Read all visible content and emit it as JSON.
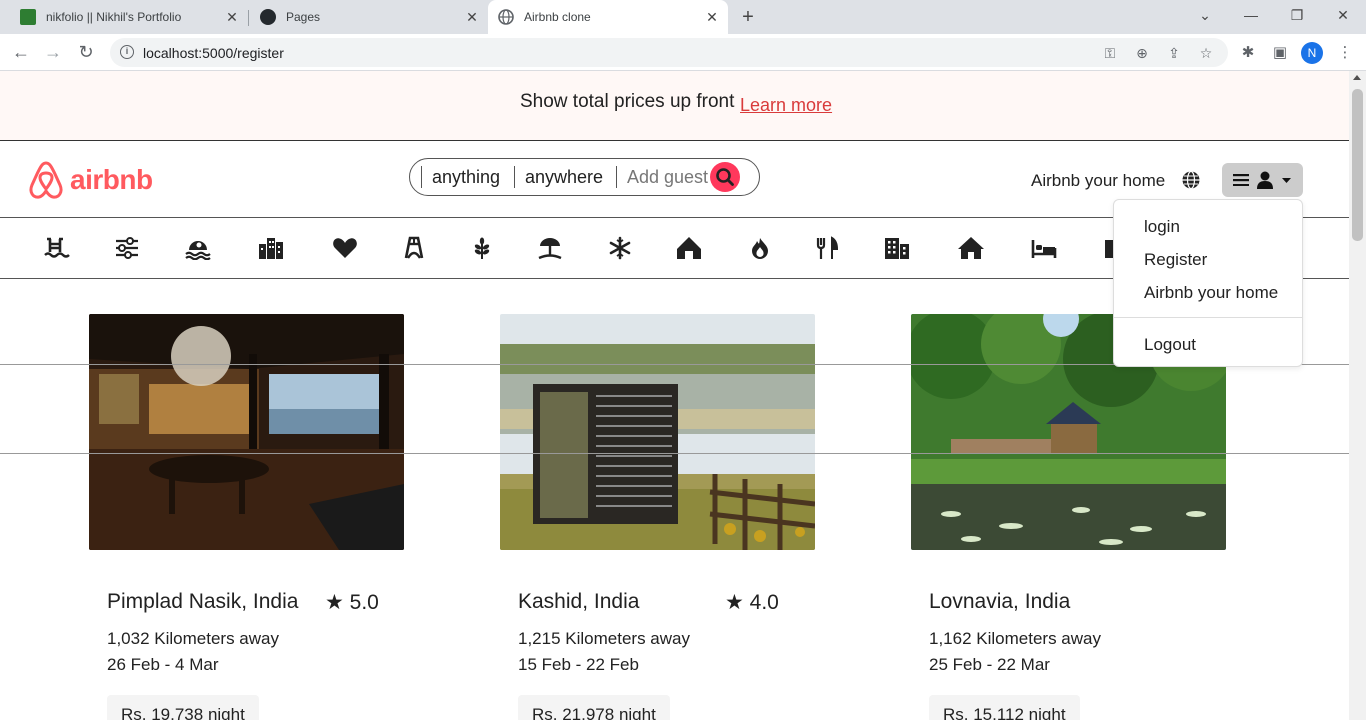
{
  "browser": {
    "tabs": [
      {
        "title": "nikfolio || Nikhil's Portfolio"
      },
      {
        "title": "Pages"
      },
      {
        "title": "Airbnb clone"
      }
    ],
    "url": "localhost:5000/register",
    "profile_initial": "N"
  },
  "promo": {
    "text": "Show total prices up front",
    "link": "Learn more"
  },
  "header": {
    "logo_text": "airbnb",
    "search": {
      "what": "anything",
      "where": "anywhere",
      "guests_placeholder": "Add guest"
    },
    "host_link": "Airbnb your home"
  },
  "menu": {
    "items": [
      "login",
      "Register",
      "Airbnb your home"
    ],
    "logout": "Logout"
  },
  "categories": [
    "pool-icon",
    "filters-icon",
    "beach-icon",
    "city-icon",
    "heart-icon",
    "bridge-icon",
    "farm-icon",
    "tropical-icon",
    "snow-icon",
    "cabin-icon",
    "trending-icon",
    "food-icon",
    "building-icon",
    "home-icon",
    "bed-icon",
    "more-icon"
  ],
  "listings": [
    {
      "title": "Pimplad Nasik, India",
      "rating": "★ 5.0",
      "distance": "1,032 Kilometers away",
      "dates": "26 Feb - 4 Mar",
      "price": "Rs. 19,738 night"
    },
    {
      "title": "Kashid, India",
      "rating": "★ 4.0",
      "distance": "1,215 Kilometers away",
      "dates": "15 Feb - 22 Feb",
      "price": "Rs. 21,978 night"
    },
    {
      "title": "Lovnavia, India",
      "rating": "",
      "distance": "1,162 Kilometers away",
      "dates": "25 Feb - 22 Mar",
      "price": "Rs. 15,112 night"
    }
  ],
  "colors": {
    "brand": "#ff5a5f",
    "search_button": "#ff385c",
    "promo_link": "#d93b3b"
  }
}
